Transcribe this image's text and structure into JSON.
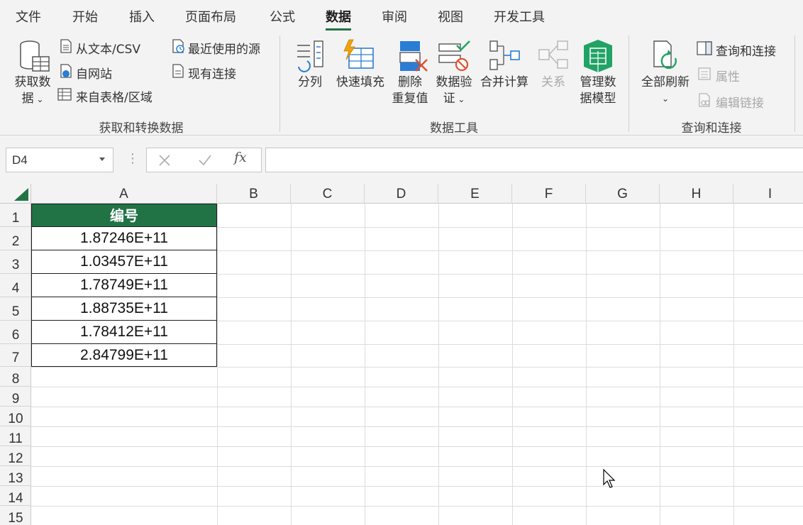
{
  "menu": {
    "tabs": [
      {
        "label": "文件"
      },
      {
        "label": "开始"
      },
      {
        "label": "插入"
      },
      {
        "label": "页面布局"
      },
      {
        "label": "公式"
      },
      {
        "label": "数据"
      },
      {
        "label": "审阅"
      },
      {
        "label": "视图"
      },
      {
        "label": "开发工具"
      }
    ],
    "active_tab": "数据"
  },
  "ribbon": {
    "get_transform": {
      "get_data_line1": "获取数",
      "get_data_line2": "据",
      "from_text_csv": "从文本/CSV",
      "from_web": "自网站",
      "from_table": "来自表格/区域",
      "recent_sources": "最近使用的源",
      "existing_connections": "现有连接",
      "group_label": "获取和转换数据"
    },
    "data_tools": {
      "text_to_columns": "分列",
      "flash_fill": "快速填充",
      "remove_dup_line1": "删除",
      "remove_dup_line2": "重复值",
      "validation_line1": "数据验",
      "validation_line2": "证",
      "consolidate": "合并计算",
      "relationships": "关系",
      "model_line1": "管理数",
      "model_line2": "据模型",
      "group_label": "数据工具"
    },
    "queries": {
      "refresh_all": "全部刷新",
      "queries_connections": "查询和连接",
      "properties": "属性",
      "edit_links": "编辑链接",
      "group_label": "查询和连接"
    },
    "colors": {
      "accent": "#217346",
      "disabled": "#a9a9a9"
    }
  },
  "formula_bar": {
    "name_box": "D4",
    "fx": "fx",
    "formula": ""
  },
  "sheet": {
    "columns": [
      "A",
      "B",
      "C",
      "D",
      "E",
      "F",
      "G",
      "H",
      "I"
    ],
    "rows": [
      "1",
      "2",
      "3",
      "4",
      "5",
      "6",
      "7",
      "8",
      "9",
      "10",
      "11",
      "12",
      "13",
      "14",
      "15"
    ],
    "header_cell": "编号",
    "values": [
      "1.87246E+11",
      "1.03457E+11",
      "1.78749E+11",
      "1.88735E+11",
      "1.78412E+11",
      "2.84799E+11"
    ]
  }
}
